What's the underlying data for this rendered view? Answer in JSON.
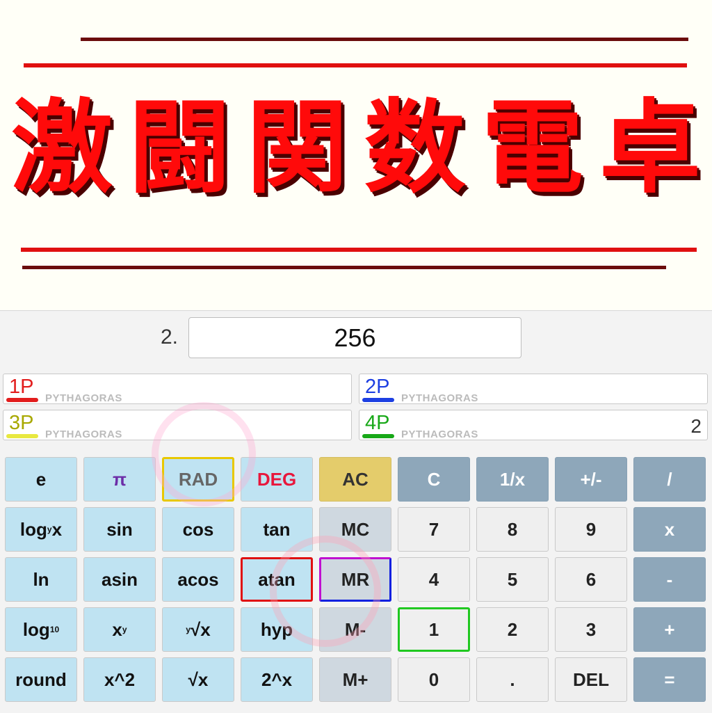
{
  "title_chars": [
    "激",
    "闘",
    "関",
    "数",
    "電",
    "卓"
  ],
  "step": "2.",
  "display_value": "256",
  "players": [
    {
      "tag": "1P",
      "name": "PYTHAGORAS",
      "score": "",
      "color": "#e21d1d"
    },
    {
      "tag": "2P",
      "name": "PYTHAGORAS",
      "score": "",
      "color": "#1d3fe2"
    },
    {
      "tag": "3P",
      "name": "PYTHAGORAS",
      "score": "",
      "color": "#a8a800"
    },
    {
      "tag": "4P",
      "name": "PYTHAGORAS",
      "score": "2",
      "color": "#18a818"
    }
  ],
  "keys": {
    "e": "e",
    "pi": "π",
    "rad": "RAD",
    "deg": "DEG",
    "ac": "AC",
    "c": "C",
    "recip": "1/x",
    "negate": "+/-",
    "divide": "/",
    "logyx": "log",
    "sin": "sin",
    "cos": "cos",
    "tan": "tan",
    "mc": "MC",
    "seven": "7",
    "eight": "8",
    "nine": "9",
    "multiply": "x",
    "ln": "ln",
    "asin": "asin",
    "acos": "acos",
    "atan": "atan",
    "mr": "MR",
    "four": "4",
    "five": "5",
    "six": "6",
    "minus": "-",
    "log10": "log",
    "xpowy": "x",
    "yroot": "√x",
    "hyp": "hyp",
    "mminus": "M-",
    "one": "1",
    "two": "2",
    "three": "3",
    "plus": "+",
    "round": "round",
    "xsq": "x^2",
    "sqrt": "√x",
    "twopowx": "2^x",
    "mplus": "M+",
    "zero": "0",
    "dot": ".",
    "del": "DEL",
    "equals": "="
  },
  "key_sub": {
    "logyx_sub": "y",
    "logyx_tail": "x",
    "log10_sub": "10",
    "xpowy_sup": "y",
    "yroot_sup": "y"
  }
}
